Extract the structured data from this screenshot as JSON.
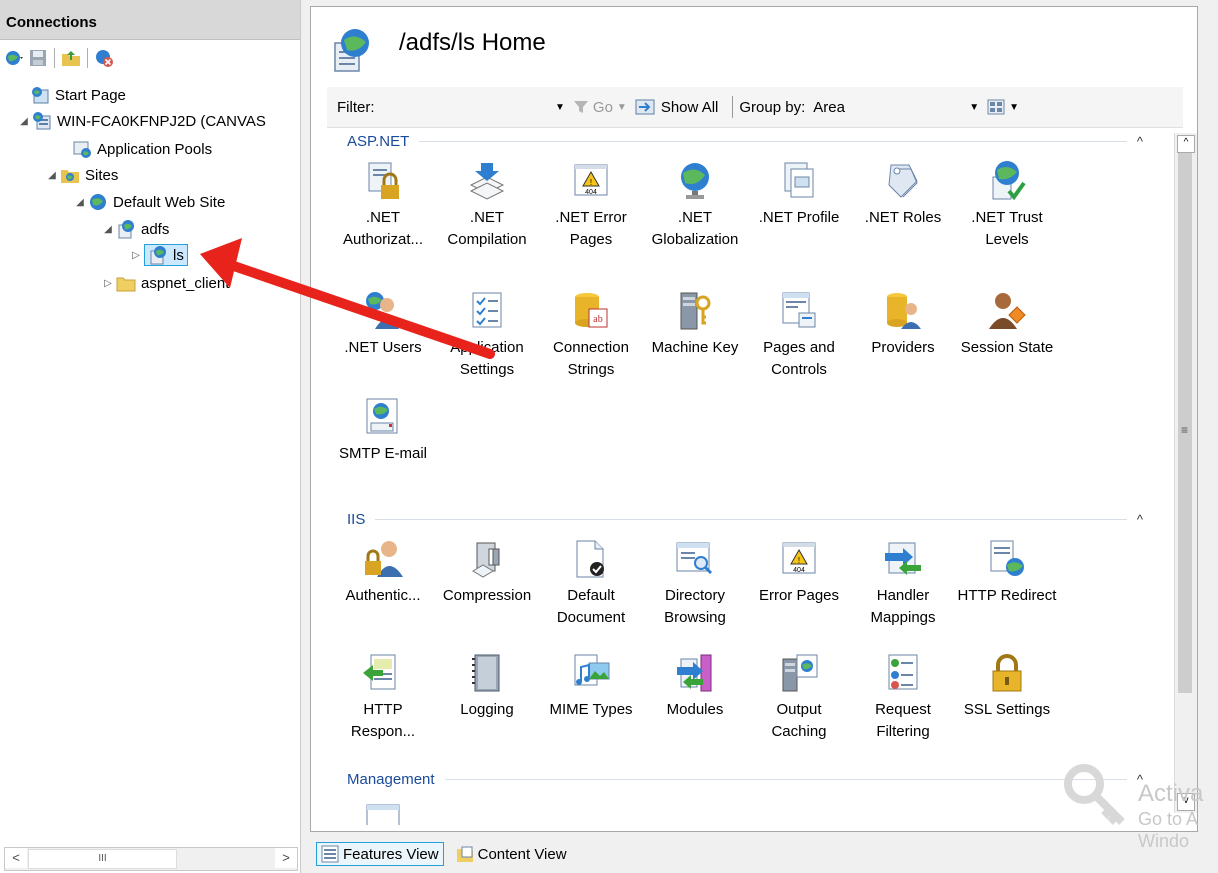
{
  "connections": {
    "header": "Connections",
    "tree": [
      {
        "label": "Start Page"
      },
      {
        "label": "WIN-FCA0KFNPJ2D (CANVAS"
      },
      {
        "label": "Application Pools"
      },
      {
        "label": "Sites"
      },
      {
        "label": "Default Web Site"
      },
      {
        "label": "adfs"
      },
      {
        "label": "ls"
      },
      {
        "label": "aspnet_client"
      }
    ],
    "scroll_left": "<",
    "scroll_right": ">",
    "scroll_grip": "III"
  },
  "page": {
    "title": "/adfs/ls Home"
  },
  "filterbar": {
    "filter_label": "Filter:",
    "go_label": "Go",
    "show_all_label": "Show All",
    "group_by_label": "Group by:",
    "group_by_value": "Area"
  },
  "sections": [
    {
      "title": "ASP.NET",
      "chevron": "^",
      "features": [
        {
          "label": ".NET Authorizat...",
          "icon": "lock-document-icon"
        },
        {
          "label": ".NET Compilation",
          "icon": "stack-down-arrow-icon"
        },
        {
          "label": ".NET Error Pages",
          "icon": "warning-404-icon"
        },
        {
          "label": ".NET Globalization",
          "icon": "globe-icon"
        },
        {
          "label": ".NET Profile",
          "icon": "profile-document-icon"
        },
        {
          "label": ".NET Roles",
          "icon": "roles-tags-icon"
        },
        {
          "label": ".NET Trust Levels",
          "icon": "globe-check-icon"
        },
        {
          "label": ".NET Users",
          "icon": "users-globe-icon"
        },
        {
          "label": "Application Settings",
          "icon": "checklist-icon"
        },
        {
          "label": "Connection Strings",
          "icon": "database-ab-icon"
        },
        {
          "label": "Machine Key",
          "icon": "server-key-icon"
        },
        {
          "label": "Pages and Controls",
          "icon": "pages-controls-icon"
        },
        {
          "label": "Providers",
          "icon": "providers-db-user-icon"
        },
        {
          "label": "Session State",
          "icon": "user-diamond-icon"
        },
        {
          "label": "SMTP E-mail",
          "icon": "mail-globe-icon"
        }
      ]
    },
    {
      "title": "IIS",
      "chevron": "^",
      "features": [
        {
          "label": "Authentic...",
          "icon": "lock-user-icon"
        },
        {
          "label": "Compression",
          "icon": "clamp-icon"
        },
        {
          "label": "Default Document",
          "icon": "document-check-icon"
        },
        {
          "label": "Directory Browsing",
          "icon": "window-search-icon"
        },
        {
          "label": "Error Pages",
          "icon": "warning-404-icon"
        },
        {
          "label": "Handler Mappings",
          "icon": "arrows-handler-icon"
        },
        {
          "label": "HTTP Redirect",
          "icon": "redirect-globe-icon"
        },
        {
          "label": "HTTP Respon...",
          "icon": "response-headers-icon"
        },
        {
          "label": "Logging",
          "icon": "notebook-icon"
        },
        {
          "label": "MIME Types",
          "icon": "music-image-icon"
        },
        {
          "label": "Modules",
          "icon": "modules-arrows-icon"
        },
        {
          "label": "Output Caching",
          "icon": "server-cache-icon"
        },
        {
          "label": "Request Filtering",
          "icon": "filter-list-icon"
        },
        {
          "label": "SSL Settings",
          "icon": "padlock-icon"
        }
      ]
    },
    {
      "title": "Management",
      "chevron": "^",
      "features": []
    }
  ],
  "view_tabs": {
    "features_view": "Features View",
    "content_view": "Content View"
  },
  "watermark": {
    "line1": "Activa",
    "line2": "Go to A",
    "line3": "Windo"
  },
  "colors": {
    "section_title": "#1a4b9b",
    "selection_border": "#26a0da",
    "arrow": "#e8231b"
  }
}
